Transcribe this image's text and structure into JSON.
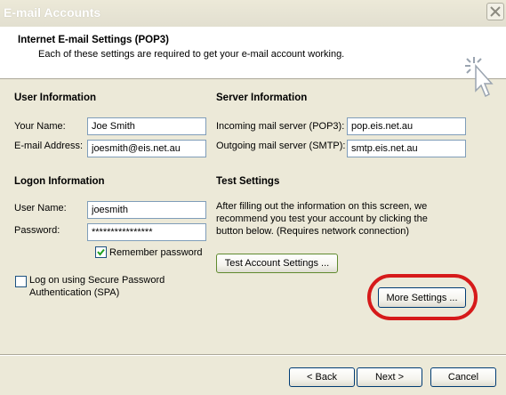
{
  "window": {
    "title": "E-mail Accounts",
    "close_icon": "close-icon"
  },
  "header": {
    "title": "Internet E-mail Settings (POP3)",
    "subtitle": "Each of these settings are required to get your e-mail account working.",
    "icon": "wizard-cursor-icon"
  },
  "user_info": {
    "heading": "User Information",
    "name_label": "Your Name:",
    "name_value": "Joe Smith",
    "email_label": "E-mail Address:",
    "email_value": "joesmith@eis.net.au"
  },
  "server_info": {
    "heading": "Server Information",
    "incoming_label": "Incoming mail server (POP3):",
    "incoming_value": "pop.eis.net.au",
    "outgoing_label": "Outgoing mail server (SMTP):",
    "outgoing_value": "smtp.eis.net.au"
  },
  "logon_info": {
    "heading": "Logon Information",
    "user_label": "User Name:",
    "user_value": "joesmith",
    "password_label": "Password:",
    "password_value": "****************",
    "remember_label": "Remember password",
    "remember_checked": true,
    "spa_label_line1": "Log on using Secure Password",
    "spa_label_line2": "Authentication (SPA)",
    "spa_checked": false
  },
  "test_settings": {
    "heading": "Test Settings",
    "desc_line1": "After filling out the information on this screen, we",
    "desc_line2": "recommend you test your account by clicking the",
    "desc_line3": "button below. (Requires network connection)",
    "test_button": "Test Account Settings ...",
    "more_button": "More Settings ..."
  },
  "footer": {
    "back": "< Back",
    "next": "Next >",
    "cancel": "Cancel"
  },
  "colors": {
    "highlight": "#d61a1a",
    "dialog_bg": "#ece9d8"
  }
}
